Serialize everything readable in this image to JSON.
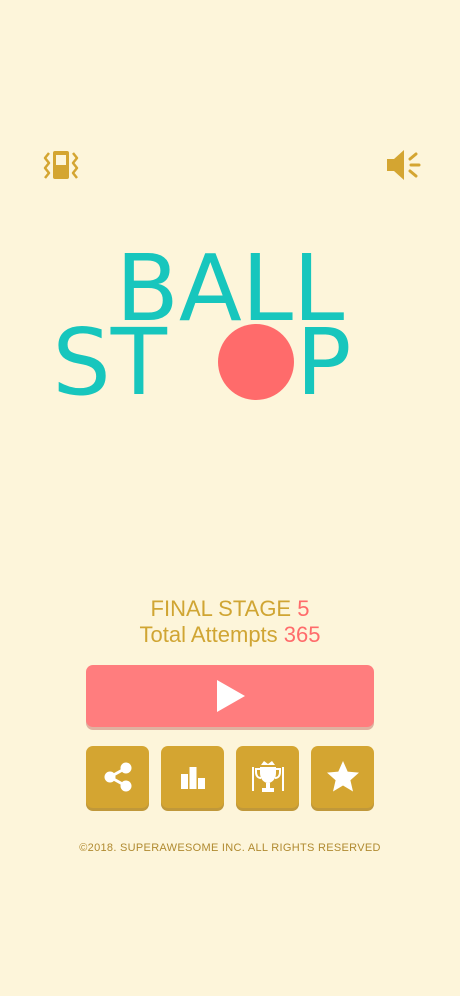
{
  "header": {
    "vibrate_icon": "vibrate-phone-icon",
    "sound_icon": "speaker-on-icon"
  },
  "logo": {
    "line1": "BALL",
    "line2_left": "ST",
    "line2_right": "P",
    "text_color": "#17c6bd",
    "ball_color": "#ff6b6b"
  },
  "stats": {
    "final_stage_label": "FINAL STAGE",
    "final_stage_value": "5",
    "attempts_label": "Total Attempts",
    "attempts_value": "365"
  },
  "buttons": {
    "play_icon": "play-icon",
    "share_icon": "share-icon",
    "leaderboard_icon": "leaderboard-icon",
    "trophy_icon": "trophy-icon",
    "rate_icon": "star-icon"
  },
  "colors": {
    "background": "#fdf5da",
    "gold": "#d4a531",
    "coral": "#ff7d7e",
    "teal": "#17c6bd"
  },
  "footer": {
    "copyright": "©2018. SUPERAWESOME INC. ALL RIGHTS RESERVED"
  }
}
